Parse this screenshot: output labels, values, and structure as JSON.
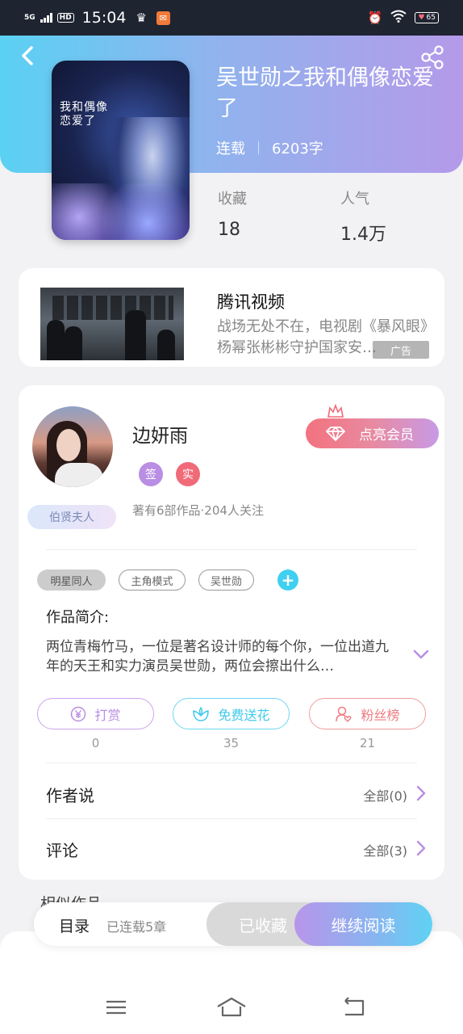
{
  "status_bar": {
    "network": "5G",
    "hd": "HD",
    "time": "15:04",
    "battery": "65"
  },
  "book": {
    "title": "吴世勋之我和偶像恋爱了",
    "cover_text": "我和偶像恋爱了",
    "status": "连载",
    "word_count": "6203字",
    "collect_label": "收藏",
    "collect_value": "18",
    "popularity_label": "人气",
    "popularity_value": "1.4万"
  },
  "ad": {
    "title": "腾讯视频",
    "description": "战场无处不在，电视剧《暴风眼》杨幂张彬彬守护国家安…",
    "tag": "广告"
  },
  "author": {
    "name": "边妍雨",
    "badges": [
      "签",
      "实"
    ],
    "badge_colors": [
      "#b98ee3",
      "#f06a78"
    ],
    "subtitle": "著有6部作品·204人关注",
    "rank": "伯贤夫人",
    "vip_button": "点亮会员"
  },
  "tags": [
    "明星同人",
    "主角模式",
    "吴世勋"
  ],
  "intro": {
    "label": "作品简介:",
    "text": "两位青梅竹马，一位是著名设计师的每个你，一位出道九年的天王和实力演员吴世勋，两位会擦出什么…"
  },
  "actions": [
    {
      "label": "打赏",
      "count": "0",
      "icon": "yuan-coin-icon",
      "color": "#b98ee3"
    },
    {
      "label": "免费送花",
      "count": "35",
      "icon": "flower-icon",
      "color": "#3fc9ea"
    },
    {
      "label": "粉丝榜",
      "count": "21",
      "icon": "fan-person-icon",
      "color": "#ef7a80"
    }
  ],
  "author_says": {
    "label": "作者说",
    "value": "全部(0)"
  },
  "comments": {
    "label": "评论",
    "value": "全部(3)"
  },
  "similar_label": "相似作品",
  "bottom_bar": {
    "toc": "目录",
    "serial": "已连载5章",
    "collected": "已收藏",
    "read": "继续阅读"
  }
}
